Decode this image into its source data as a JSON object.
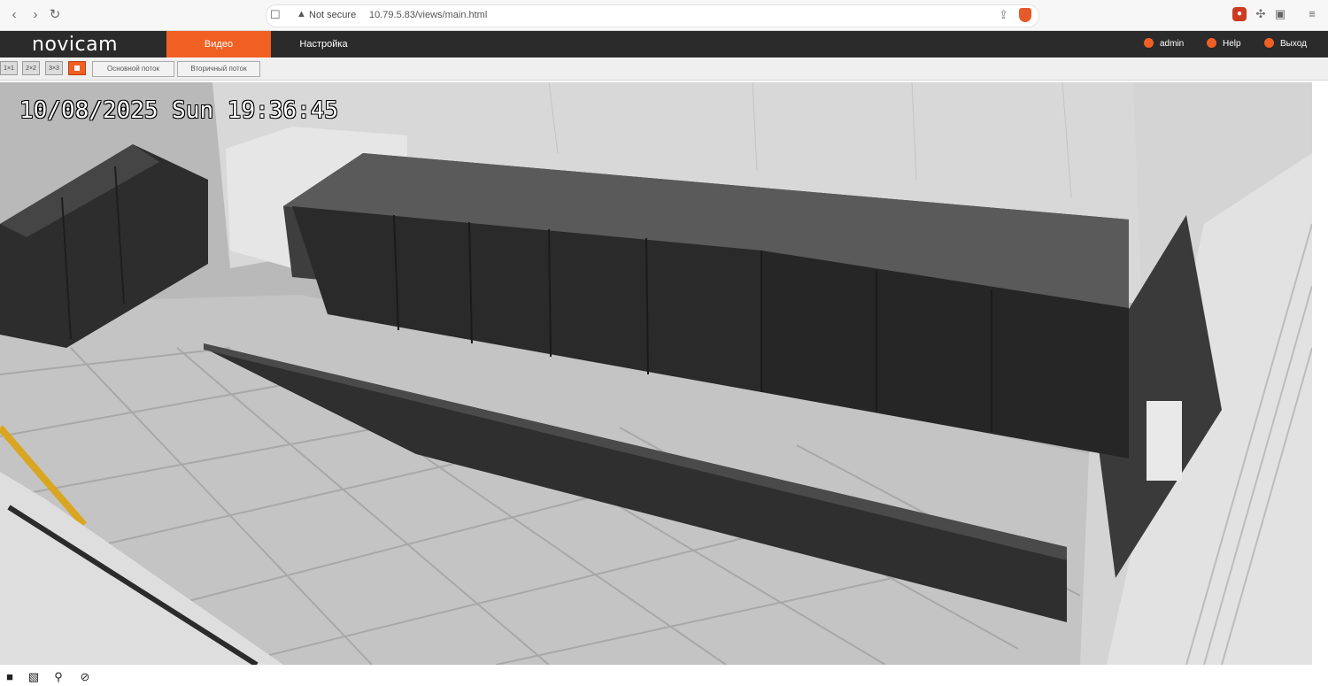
{
  "browser": {
    "nav": {
      "back": "‹",
      "forward": "›",
      "reload": "↻"
    },
    "url": {
      "security_label": "Not secure",
      "address": "10.79.5.83/views/main.html"
    }
  },
  "app": {
    "logo": "novicam",
    "tabs": [
      {
        "label": "Видео",
        "active": true
      },
      {
        "label": "Настройка",
        "active": false
      }
    ],
    "header_right": [
      {
        "label": "admin",
        "icon": "user-icon"
      },
      {
        "label": "Help",
        "icon": "help-icon"
      },
      {
        "label": "Выход",
        "icon": "logout-icon"
      }
    ],
    "accent_color": "#f06022",
    "header_bg": "#2b2b2b"
  },
  "toolbar": {
    "layout_buttons": [
      "1×1",
      "2×2",
      "3×3"
    ],
    "streams": {
      "main": "Основной поток",
      "secondary": "Вторичный поток"
    }
  },
  "video": {
    "osd_timestamp": "10/08/2025 Sun 19:36:45"
  },
  "bottombar": {
    "icons": [
      "stop-icon",
      "snapshot-icon",
      "zoom-icon",
      "hide-icon"
    ]
  }
}
